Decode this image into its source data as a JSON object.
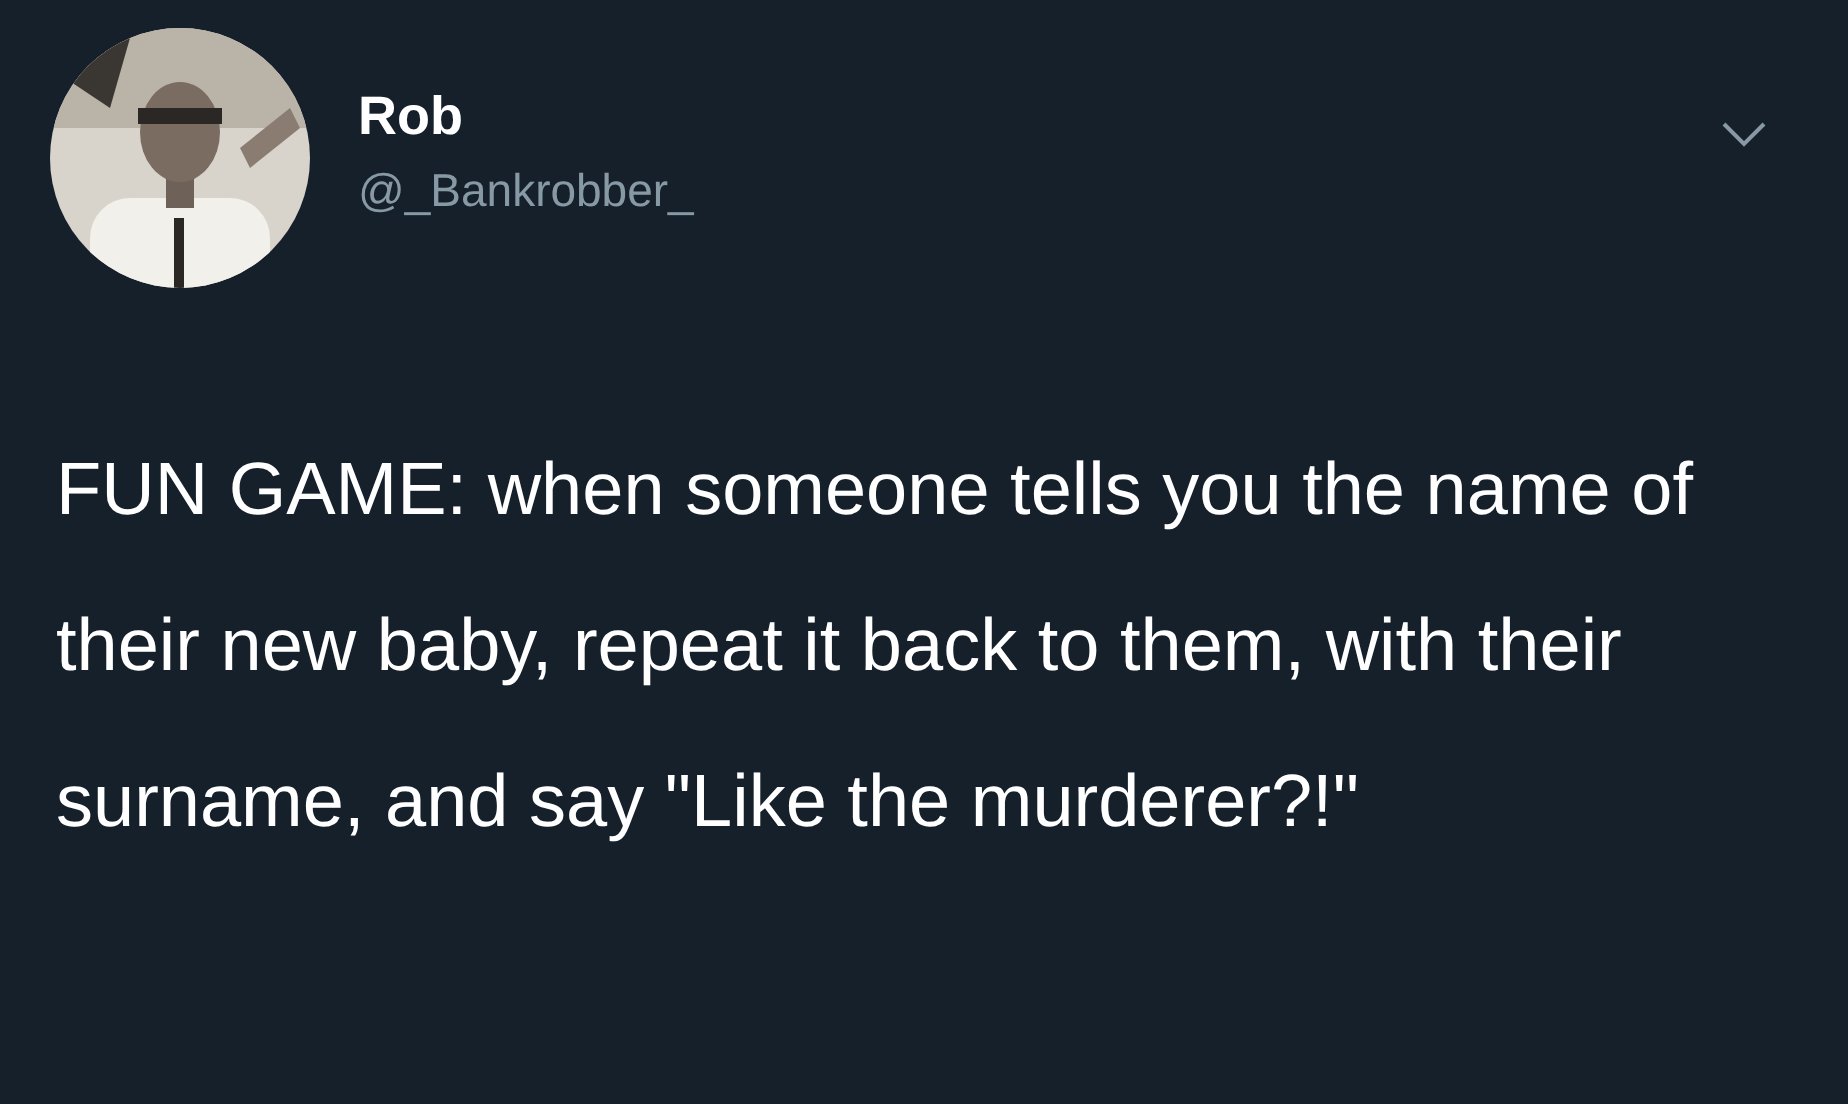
{
  "author": {
    "name": "Rob",
    "handle": "@_Bankrobber_"
  },
  "tweet": {
    "text": "FUN GAME: when someone tells you the name of their new baby, repeat it back to them, with their surname, and say \"Like the murderer?!\""
  }
}
